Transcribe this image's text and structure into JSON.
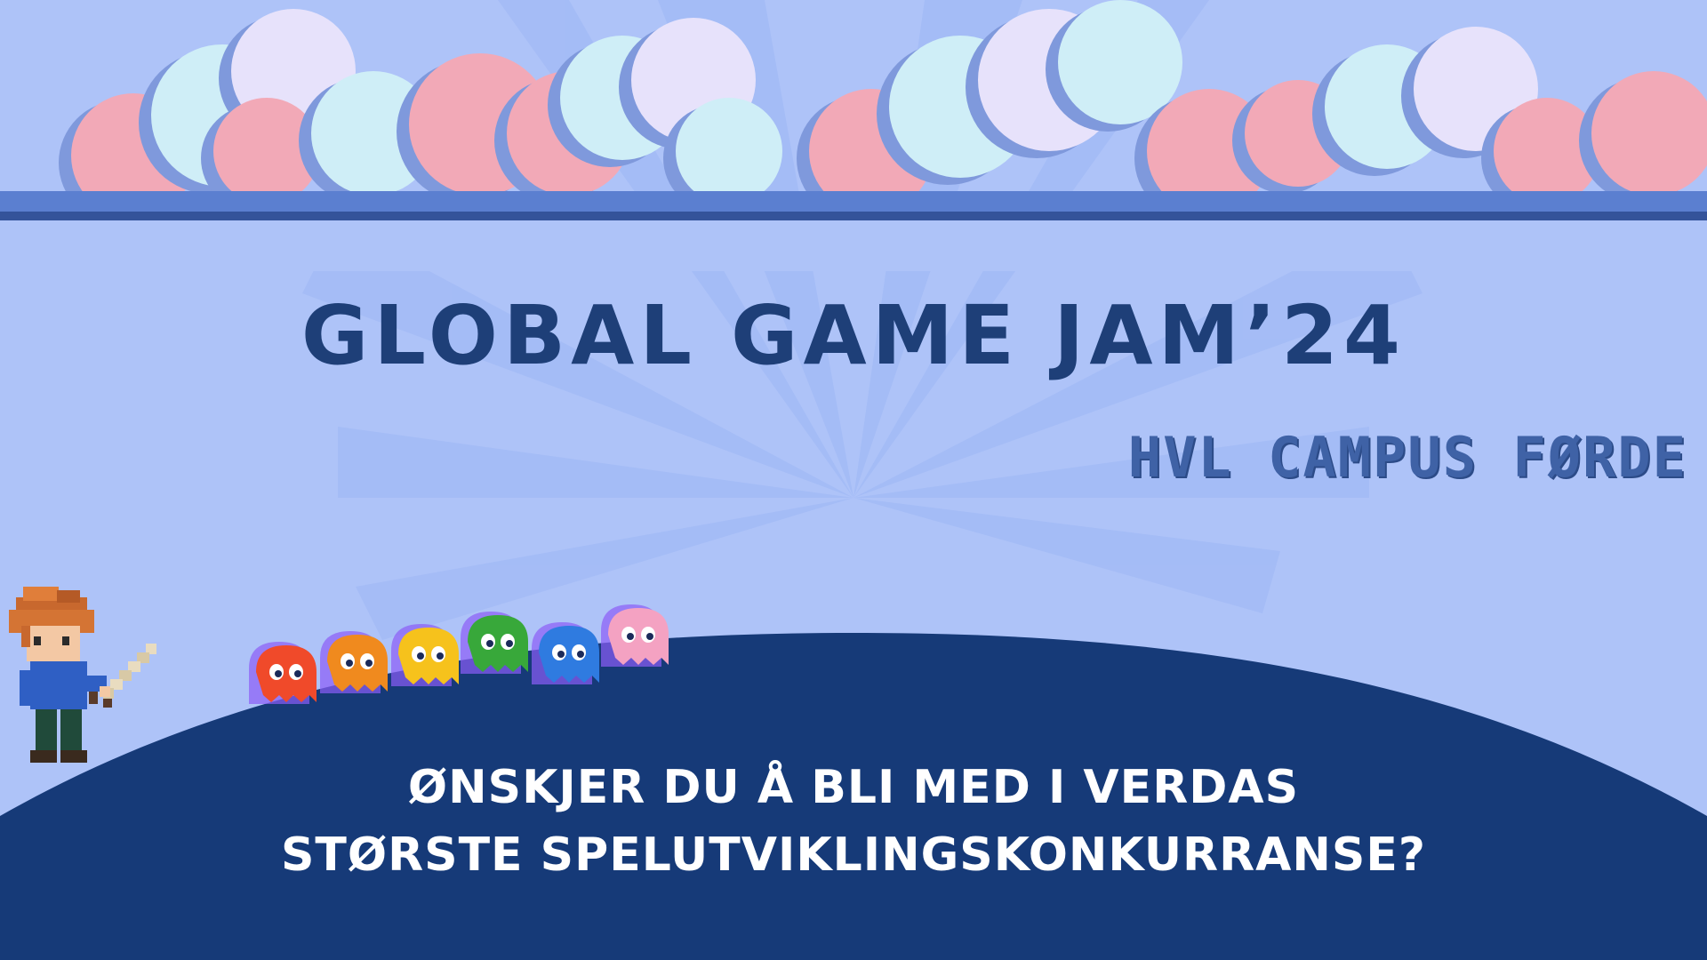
{
  "poster": {
    "title": "GLOBAL GAME JAM’24",
    "subtitle": "HVL CAMPUS FØRDE",
    "question_line1": "ØNSKJER DU Å BLI MED I VERDAS",
    "question_line2": "STØRSTE SPELUTVIKLINGSKONKURRANSE?"
  },
  "colors": {
    "background": "#aec3f8",
    "hill": "#163a78",
    "title": "#1e3f78",
    "subtitle": "#3f62a6",
    "question_text": "#ffffff"
  },
  "decor": {
    "clouds": "pixel-cloud-band",
    "character": "pixel-hero-with-sword",
    "ghosts": [
      "red-ghost",
      "orange-ghost",
      "yellow-ghost",
      "green-ghost",
      "blue-ghost",
      "pink-ghost"
    ]
  }
}
